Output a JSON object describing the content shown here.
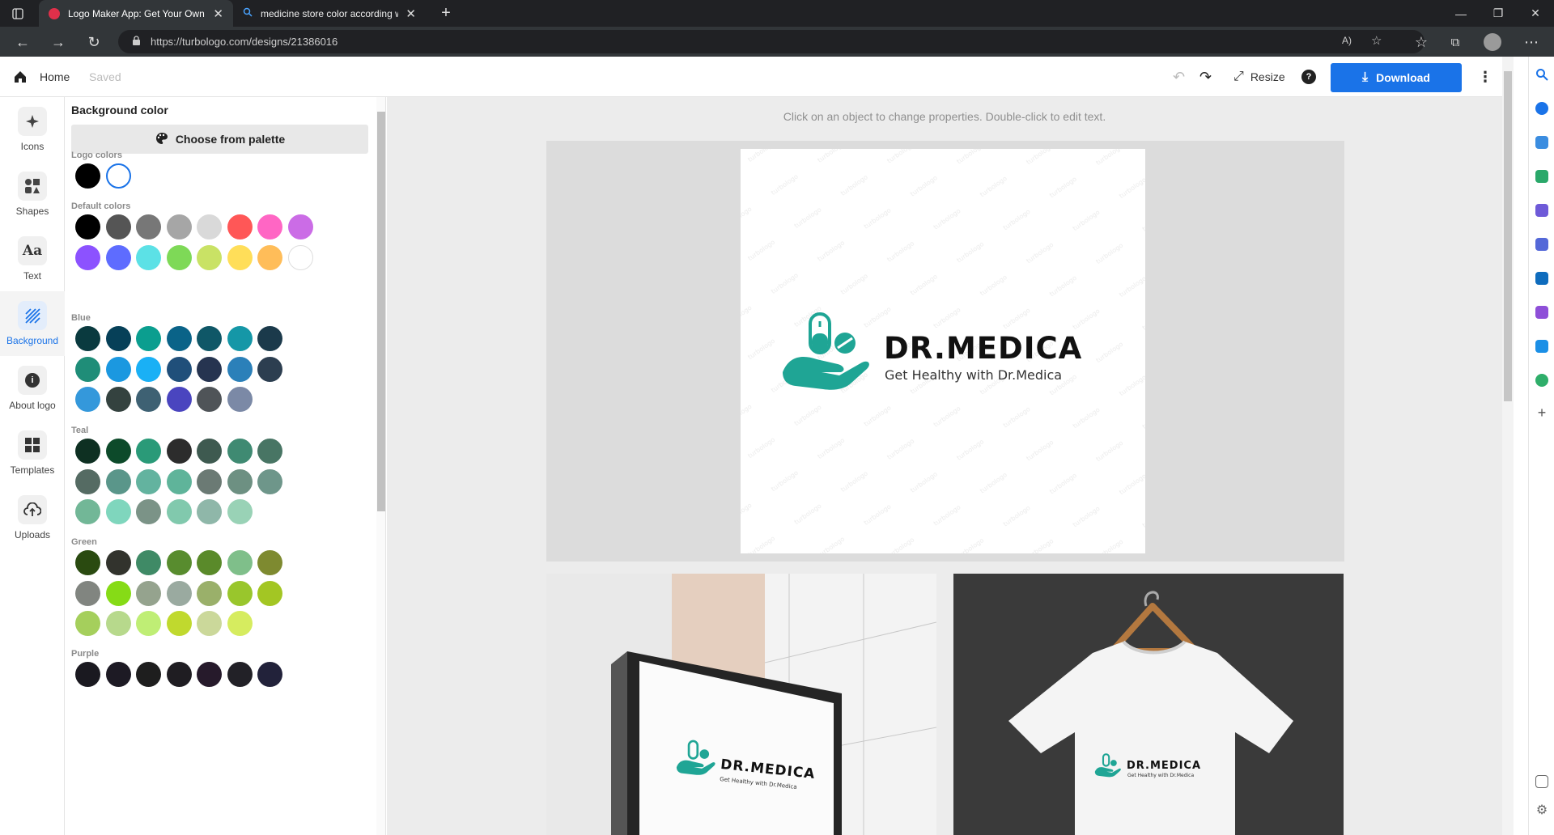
{
  "browser": {
    "tabs": [
      {
        "title": "Logo Maker App: Get Your Own"
      },
      {
        "title": "medicine store color according w"
      }
    ],
    "url": "https://turbologo.com/designs/21386016"
  },
  "header": {
    "home_label": "Home",
    "saved_label": "Saved",
    "resize_label": "Resize",
    "download_label": "Download"
  },
  "rail": [
    {
      "label": "Icons",
      "icon": "sparkle-icon"
    },
    {
      "label": "Shapes",
      "icon": "shapes-icon"
    },
    {
      "label": "Text",
      "icon": "text-icon"
    },
    {
      "label": "Background",
      "icon": "background-icon"
    },
    {
      "label": "About logo",
      "icon": "info-icon"
    },
    {
      "label": "Templates",
      "icon": "templates-icon"
    },
    {
      "label": "Uploads",
      "icon": "cloud-upload-icon"
    }
  ],
  "panel": {
    "title": "Background color",
    "palette_button": "Choose from palette",
    "sections": [
      {
        "label": "Logo colors",
        "colors": [
          "#000000",
          "#ffffff"
        ]
      },
      {
        "label": "Default colors",
        "colors": [
          "#000000",
          "#555555",
          "#777777",
          "#a6a6a6",
          "#d9d9d9",
          "#ff5757",
          "#ff66c4",
          "#cb6ce6",
          "#8c52ff",
          "#5e6cff",
          "#5ce1e6",
          "#7ed957",
          "#c9e265",
          "#ffde59",
          "#ffbd59",
          "#ffffff"
        ]
      },
      {
        "label": "Blue",
        "colors": [
          "#0a3a3f",
          "#064058",
          "#0b9e8f",
          "#0a6388",
          "#0f5767",
          "#1597a7",
          "#1b3a4b",
          "#1f8d78",
          "#1b98e0",
          "#1ab0f5",
          "#204f7a",
          "#263450",
          "#2b80b9",
          "#2c3e50",
          "#3498db",
          "#34423f",
          "#3e6173",
          "#4a45bf",
          "#4f5458",
          "#7b89a6"
        ]
      },
      {
        "label": "Teal",
        "colors": [
          "#0e3022",
          "#0d4a2a",
          "#2a9a78",
          "#2c2c2c",
          "#3e5a50",
          "#3f8a72",
          "#487564",
          "#556b63",
          "#5a968a",
          "#63b39f",
          "#5fb49a",
          "#6b7a74",
          "#6d9082",
          "#6e968a",
          "#72b797",
          "#7fd6bd",
          "#7b9387",
          "#81c9ad",
          "#8fb7a9",
          "#99d2b6"
        ]
      },
      {
        "label": "Green",
        "colors": [
          "#2a4a10",
          "#32332d",
          "#3f8a66",
          "#588c2e",
          "#5a8a2a",
          "#7fbf8a",
          "#7e8a30",
          "#818580",
          "#86db16",
          "#95a38e",
          "#9aaaa0",
          "#9ab06a",
          "#99c62c",
          "#a3c623",
          "#a5cf5c",
          "#b7d98c",
          "#bfee75",
          "#c0d92e",
          "#cbd89a",
          "#d6ec5f"
        ]
      },
      {
        "label": "Purple",
        "colors": [
          "#1a1920",
          "#1d1a24",
          "#1e1e1e",
          "#1f1d22",
          "#261a2b",
          "#222127",
          "#22223a"
        ]
      }
    ]
  },
  "canvas": {
    "hint": "Click on an object to change properties. Double-click to edit text.",
    "logo_name": "DR.MEDICA",
    "logo_tagline": "Get Healthy with Dr.Medica",
    "accent_color": "#1fa595",
    "watermark": "turbologo"
  }
}
